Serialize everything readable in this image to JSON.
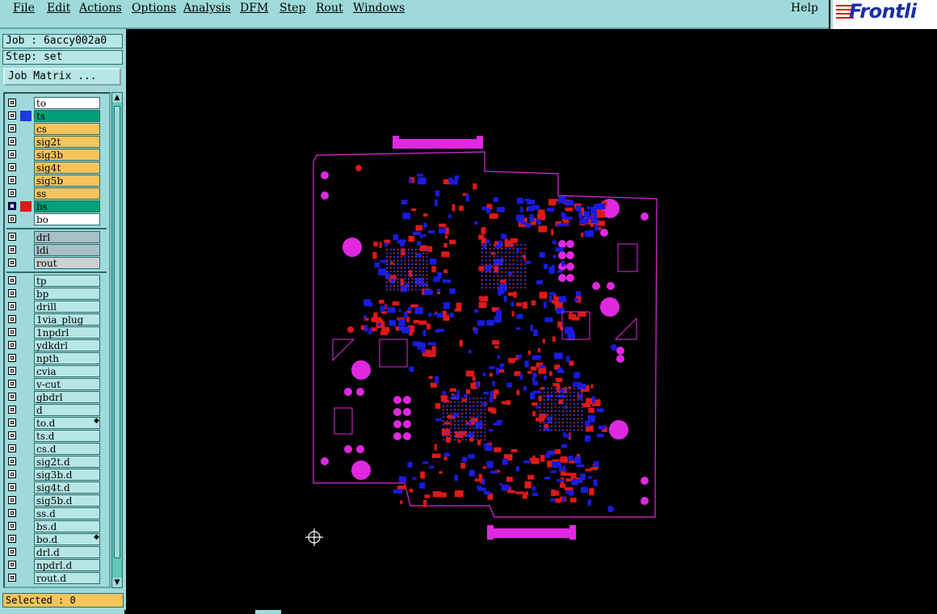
{
  "menu": {
    "items": [
      "File",
      "Edit",
      "Actions",
      "Options",
      "Analysis",
      "DFM",
      "Step",
      "Rout",
      "Windows"
    ],
    "help": "Help"
  },
  "logo": {
    "text": "Frontli"
  },
  "job": {
    "label": "Job : 6accy002a0",
    "step": "Step: set",
    "matrix_button": "Job Matrix ..."
  },
  "layers": {
    "board": [
      {
        "name": "to",
        "color": "#ffffff"
      },
      {
        "name": "ts",
        "color": "#00a078",
        "swatch": "#1a3ae0"
      },
      {
        "name": "cs",
        "color": "#f5c45a"
      },
      {
        "name": "sig2t",
        "color": "#f5c45a"
      },
      {
        "name": "sig3b",
        "color": "#f5c45a"
      },
      {
        "name": "sig4t",
        "color": "#f5c45a"
      },
      {
        "name": "sig5b",
        "color": "#f5c45a"
      },
      {
        "name": "ss",
        "color": "#f5c45a"
      },
      {
        "name": "bs",
        "color": "#00a078",
        "swatch": "#e01818",
        "active": true
      },
      {
        "name": "bo",
        "color": "#ffffff"
      }
    ],
    "drill": [
      {
        "name": "drl",
        "color": "#a8c0c8"
      },
      {
        "name": "ldi",
        "color": "#a8c0c8"
      },
      {
        "name": "rout",
        "color": "#d0d0d0"
      }
    ],
    "misc": [
      {
        "name": "tp"
      },
      {
        "name": "bp"
      },
      {
        "name": "drill"
      },
      {
        "name": "1via_plug"
      },
      {
        "name": "1npdrl"
      },
      {
        "name": "ydkdrl"
      },
      {
        "name": "npth"
      },
      {
        "name": "cvia"
      },
      {
        "name": "v-cut"
      },
      {
        "name": "gbdrl"
      },
      {
        "name": "d"
      },
      {
        "name": "to.d",
        "marker": true
      },
      {
        "name": "ts.d"
      },
      {
        "name": "cs.d"
      },
      {
        "name": "sig2t.d"
      },
      {
        "name": "sig3b.d"
      },
      {
        "name": "sig4t.d"
      },
      {
        "name": "sig5b.d"
      },
      {
        "name": "ss.d"
      },
      {
        "name": "bs.d"
      },
      {
        "name": "bo.d",
        "marker": true
      },
      {
        "name": "drl.d"
      },
      {
        "name": "npdrl.d"
      },
      {
        "name": "rout.d"
      }
    ]
  },
  "status": {
    "selected": "Selected : 0"
  },
  "colors": {
    "panel": "#9fdada",
    "outline": "#e028e0",
    "top_copper": "#1a1ae0",
    "bottom_copper": "#e01818"
  }
}
